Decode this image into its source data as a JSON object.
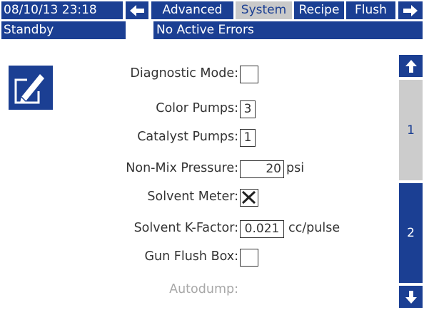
{
  "header": {
    "datetime": "08/10/13 23:18",
    "tabs": [
      {
        "label": "Advanced"
      },
      {
        "label": "System"
      },
      {
        "label": "Recipe"
      },
      {
        "label": "Flush"
      }
    ],
    "active_tab": "System"
  },
  "status": {
    "state": "Standby",
    "errors": "No Active Errors"
  },
  "form": {
    "diagnostic_mode": {
      "label": "Diagnostic Mode:",
      "checked": false
    },
    "color_pumps": {
      "label": "Color Pumps:",
      "value": "3"
    },
    "catalyst_pumps": {
      "label": "Catalyst Pumps:",
      "value": "1"
    },
    "non_mix_pressure": {
      "label": "Non-Mix Pressure:",
      "value": "20",
      "unit": "psi"
    },
    "solvent_meter": {
      "label": "Solvent Meter:",
      "checked": true
    },
    "solvent_k_factor": {
      "label": "Solvent K-Factor:",
      "value": "0.021",
      "unit": "cc/pulse"
    },
    "gun_flush_box": {
      "label": "Gun Flush Box:",
      "checked": false
    },
    "autodump": {
      "label": "Autodump:"
    }
  },
  "pages": [
    {
      "label": "1",
      "active": true
    },
    {
      "label": "2",
      "active": false
    }
  ],
  "colors": {
    "primary": "#1b3f93",
    "active_tab": "#c9c9c9",
    "disabled_text": "#a8a8a8"
  },
  "icons": [
    "arrow-left-icon",
    "arrow-right-icon",
    "edit-icon",
    "arrow-up-icon",
    "arrow-down-icon",
    "x-mark-icon"
  ]
}
